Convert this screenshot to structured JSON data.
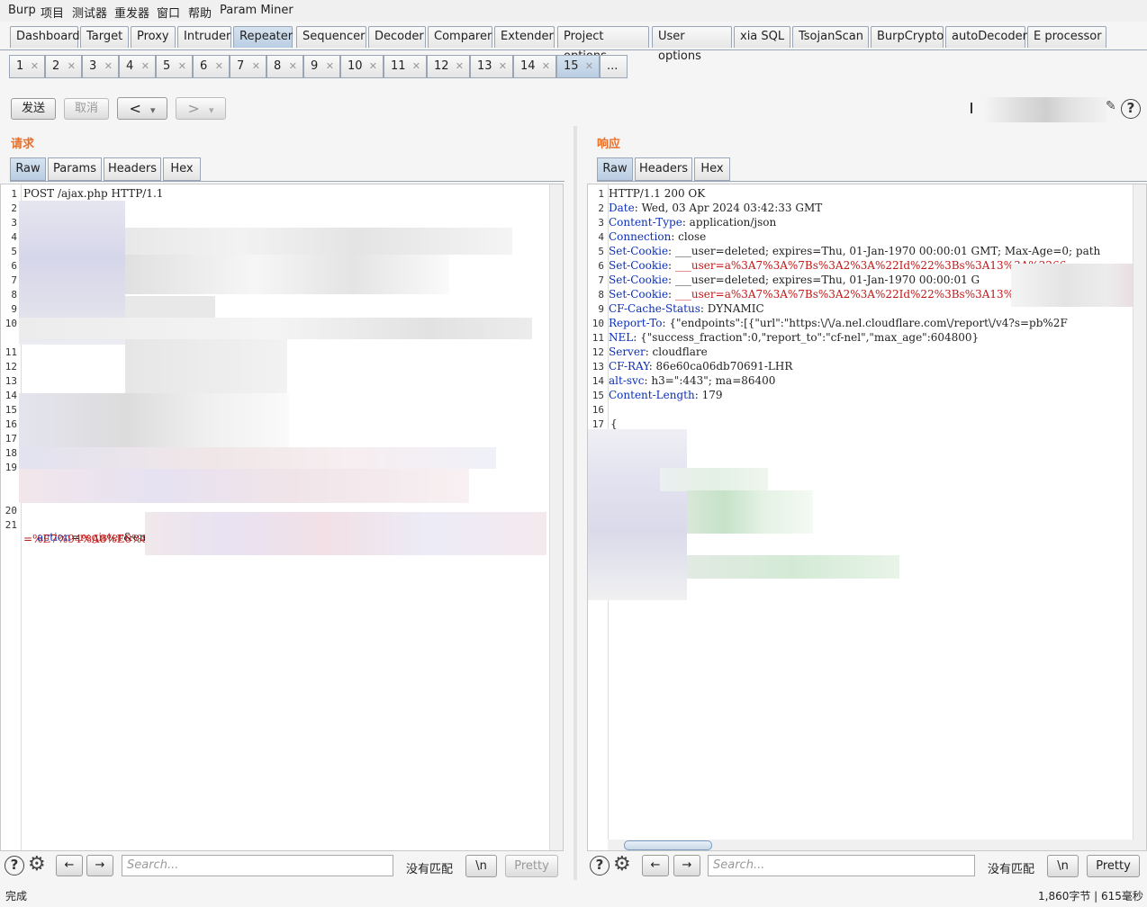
{
  "menu": [
    "Burp",
    "项目",
    "测试器",
    "重发器",
    "窗口",
    "帮助",
    "Param Miner"
  ],
  "main_tabs": [
    "Dashboard",
    "Target",
    "Proxy",
    "Intruder",
    "Repeater",
    "Sequencer",
    "Decoder",
    "Comparer",
    "Extender",
    "Project options",
    "User options",
    "xia SQL",
    "TsojanScan",
    "BurpCrypto",
    "autoDecoder",
    "E processor"
  ],
  "active_main_tab": "Repeater",
  "repeater_tabs": [
    "1",
    "2",
    "3",
    "4",
    "5",
    "6",
    "7",
    "8",
    "9",
    "10",
    "11",
    "12",
    "13",
    "14",
    "15",
    "..."
  ],
  "active_repeater_tab": "15",
  "toolbar": {
    "send": "发送",
    "cancel": "取消",
    "back": "<",
    "forward": ">",
    "dropdown": "▾",
    "help": "?"
  },
  "request": {
    "title": "请求",
    "tabs": [
      "Raw",
      "Params",
      "Headers",
      "Hex"
    ],
    "active_tab": "Raw",
    "first_line": "POST /ajax.php HTTP/1.1",
    "body_key": "action",
    "body_eq": "=",
    "body_val": "register",
    "body_amp": "&ema",
    "body_tail": "e",
    "body_line2": "=%E7%94%A8%E6%88%B7",
    "line_numbers": [
      "1",
      "2",
      "3",
      "4",
      "5",
      "6",
      "7",
      "8",
      "9",
      "10",
      "11",
      "12",
      "13",
      "14",
      "15",
      "16",
      "17",
      "18",
      "19",
      "20",
      "21"
    ]
  },
  "response": {
    "title": "响应",
    "tabs": [
      "Raw",
      "Headers",
      "Hex"
    ],
    "active_tab": "Raw",
    "status_line": "HTTP/1.1 200 OK",
    "headers": [
      {
        "k": "Date",
        "v": " Wed, 03 Apr 2024 03:42:33 GMT",
        "red": false
      },
      {
        "k": "Content-Type",
        "v": " application/json",
        "red": false
      },
      {
        "k": "Connection",
        "v": " close",
        "red": false
      },
      {
        "k": "Set-Cookie",
        "v": " ___user=deleted; expires=Thu, 01-Jan-1970 00:00:01 GMT; Max-Age=0; path",
        "red": false
      },
      {
        "k": "Set-Cookie",
        "v": " ___user=a%3A7%3A%7Bs%3A2%3A%22Id%22%3Bs%3A13%3A%2266",
        "red": true
      },
      {
        "k": "Set-Cookie",
        "v": " ___user=deleted; expires=Thu, 01-Jan-1970 00:00:01 G",
        "red": false
      },
      {
        "k": "Set-Cookie",
        "v": " ___user=a%3A7%3A%7Bs%3A2%3A%22Id%22%3Bs%3A13%3A%2266",
        "red": true
      },
      {
        "k": "CF-Cache-Status",
        "v": " DYNAMIC",
        "red": false
      },
      {
        "k": "Report-To",
        "v": " {\"endpoints\":[{\"url\":\"https:\\/\\/a.nel.cloudflare.com\\/report\\/v4?s=pb%2F",
        "red": false
      },
      {
        "k": "NEL",
        "v": " {\"success_fraction\":0,\"report_to\":\"cf-nel\",\"max_age\":604800}",
        "red": false
      },
      {
        "k": "Server",
        "v": " cloudflare",
        "red": false
      },
      {
        "k": "CF-RAY",
        "v": " 86e60ca06db70691-LHR",
        "red": false
      },
      {
        "k": "alt-svc",
        "v": " h3=\":443\"; ma=86400",
        "red": false
      },
      {
        "k": "Content-Length",
        "v": " 179",
        "red": false
      }
    ],
    "body_open": "{",
    "line_numbers": [
      "1",
      "2",
      "3",
      "4",
      "5",
      "6",
      "7",
      "8",
      "9",
      "10",
      "11",
      "12",
      "13",
      "14",
      "15",
      "16",
      "17"
    ]
  },
  "bottom": {
    "search_placeholder": "Search...",
    "no_match": "没有匹配",
    "newline_btn": "\\n",
    "pretty_btn": "Pretty",
    "back_arrow": "←",
    "fwd_arrow": "→"
  },
  "statusbar": {
    "left": "完成",
    "right": "1,860字节 | 615毫秒"
  },
  "colors": {
    "header_key": "#0b2fb8",
    "value_red": "#c01818",
    "section_title": "#e8702a",
    "active_tab": "#c6d6e8"
  }
}
